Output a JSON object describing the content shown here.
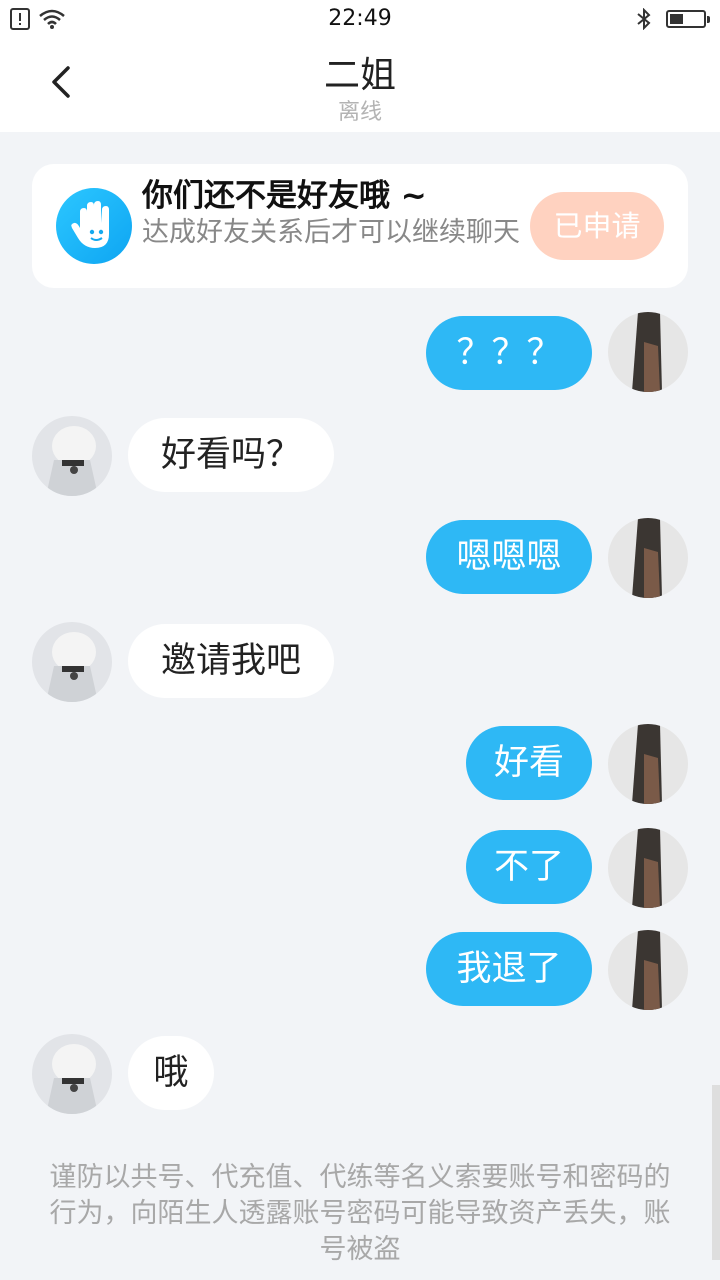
{
  "status_bar": {
    "time": "22:49",
    "battery_level": 0.4,
    "left_icons": [
      "sim-alert-icon",
      "wifi-icon"
    ],
    "right_icons": [
      "bluetooth-icon",
      "battery-icon"
    ]
  },
  "header": {
    "title": "二姐",
    "status": "离线",
    "back_icon": "chevron-left-icon"
  },
  "friend_card": {
    "icon": "hand-wave-icon",
    "title": "你们还不是好友哦 ~",
    "description": "达成好友关系后才可以继续聊天",
    "button_label": "已申请"
  },
  "messages": [
    {
      "direction": "out",
      "text": "？？？"
    },
    {
      "direction": "in",
      "text": "好看吗？"
    },
    {
      "direction": "out",
      "text": "嗯嗯嗯"
    },
    {
      "direction": "in",
      "text": "邀请我吧"
    },
    {
      "direction": "out",
      "text": "好看"
    },
    {
      "direction": "out",
      "text": "不了"
    },
    {
      "direction": "out",
      "text": "我退了"
    },
    {
      "direction": "in",
      "text": "哦"
    }
  ],
  "notice": "谨防以共号、代充值、代练等名义索要账号和密码的行为，向陌生人透露账号密码可能导致资产丢失，账号被盗",
  "colors": {
    "outgoing_bubble": "#2eb8f5",
    "incoming_bubble": "#ffffff",
    "background": "#f2f4f7",
    "applied_button": "#ffd2c0"
  }
}
